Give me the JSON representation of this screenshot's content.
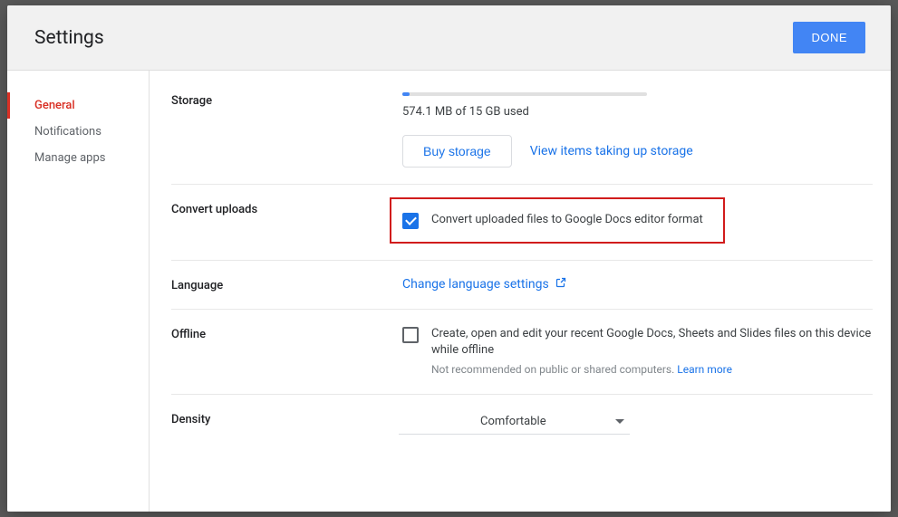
{
  "header": {
    "title": "Settings",
    "done": "DONE"
  },
  "sidebar": {
    "items": [
      {
        "label": "General",
        "active": true
      },
      {
        "label": "Notifications",
        "active": false
      },
      {
        "label": "Manage apps",
        "active": false
      }
    ]
  },
  "storage": {
    "label": "Storage",
    "used_text": "574.1 MB of 15 GB used",
    "buy": "Buy storage",
    "view_link": "View items taking up storage",
    "percent": 3.7
  },
  "convert": {
    "label": "Convert uploads",
    "checked": true,
    "text": "Convert uploaded files to Google Docs editor format"
  },
  "language": {
    "label": "Language",
    "link": "Change language settings"
  },
  "offline": {
    "label": "Offline",
    "checked": false,
    "text": "Create, open and edit your recent Google Docs, Sheets and Slides files on this device while offline",
    "note_prefix": "Not recommended on public or shared computers. ",
    "learn_more": "Learn more"
  },
  "density": {
    "label": "Density",
    "value": "Comfortable"
  }
}
